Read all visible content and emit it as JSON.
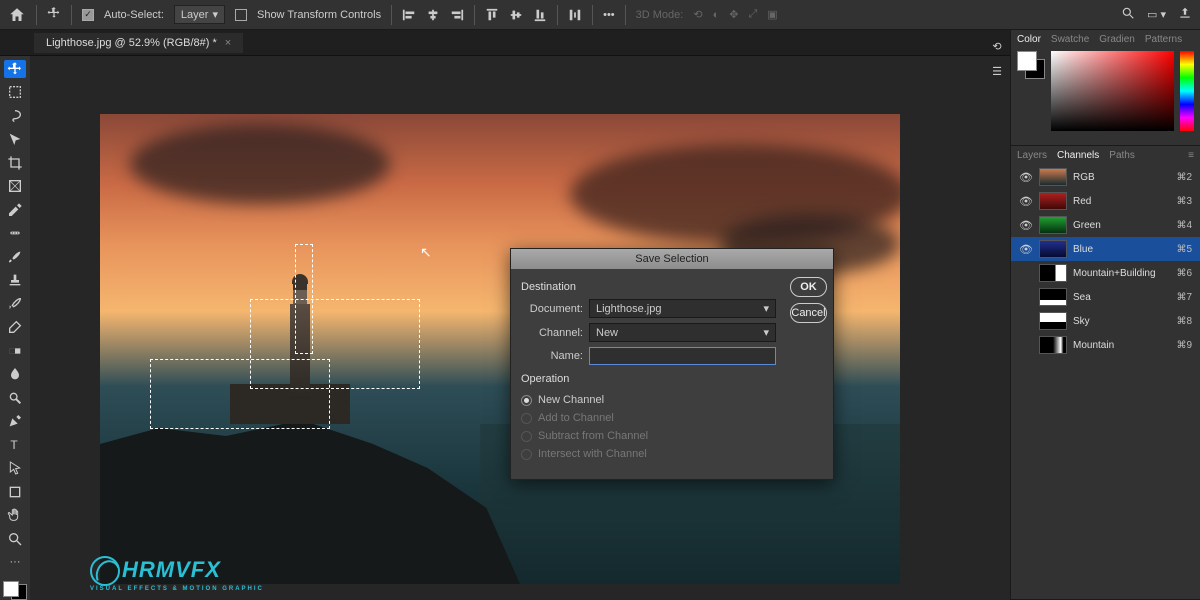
{
  "optbar": {
    "autoselect_label": "Auto-Select:",
    "layer_dd": "Layer",
    "transform_label": "Show Transform Controls",
    "mode3d_label": "3D Mode:"
  },
  "doctab": {
    "title": "Lighthose.jpg @ 52.9% (RGB/8#) *"
  },
  "dialog": {
    "title": "Save Selection",
    "destination_label": "Destination",
    "document_label": "Document:",
    "document_value": "Lighthose.jpg",
    "channel_label": "Channel:",
    "channel_value": "New",
    "name_label": "Name:",
    "name_value": "",
    "operation_label": "Operation",
    "ops": {
      "newchannel": "New Channel",
      "add": "Add to Channel",
      "subtract": "Subtract from Channel",
      "intersect": "Intersect with Channel"
    },
    "ok": "OK",
    "cancel": "Cancel"
  },
  "panels": {
    "color_tabs": {
      "color": "Color",
      "swatches": "Swatche",
      "gradients": "Gradien",
      "patterns": "Patterns"
    },
    "ch_tabs": {
      "layers": "Layers",
      "channels": "Channels",
      "paths": "Paths"
    },
    "channels": [
      {
        "name": "RGB",
        "short": "⌘2",
        "eye": true,
        "sel": false,
        "thumb": "linear-gradient(#c97a4f,#1a2c30)"
      },
      {
        "name": "Red",
        "short": "⌘3",
        "eye": true,
        "sel": false,
        "thumb": "linear-gradient(#b02020,#400808)"
      },
      {
        "name": "Green",
        "short": "⌘4",
        "eye": true,
        "sel": false,
        "thumb": "linear-gradient(#20a030,#063012)"
      },
      {
        "name": "Blue",
        "short": "⌘5",
        "eye": true,
        "sel": true,
        "thumb": "linear-gradient(#203090,#060a30)"
      },
      {
        "name": "Mountain+Building",
        "short": "⌘6",
        "eye": false,
        "sel": false,
        "thumb": "linear-gradient(to right,#000 60%,#fff 60%)"
      },
      {
        "name": "Sea",
        "short": "⌘7",
        "eye": false,
        "sel": false,
        "thumb": "linear-gradient(#000 70%,#fff 70%)"
      },
      {
        "name": "Sky",
        "short": "⌘8",
        "eye": false,
        "sel": false,
        "thumb": "linear-gradient(#fff 55%,#000 55%)"
      },
      {
        "name": "Mountain",
        "short": "⌘9",
        "eye": false,
        "sel": false,
        "thumb": "linear-gradient(to right,#000 50%,#fff 80%,#000 90%)"
      }
    ]
  },
  "logo": {
    "text": "HRMVFX",
    "sub": "VISUAL EFFECTS & MOTION GRAPHIC"
  }
}
